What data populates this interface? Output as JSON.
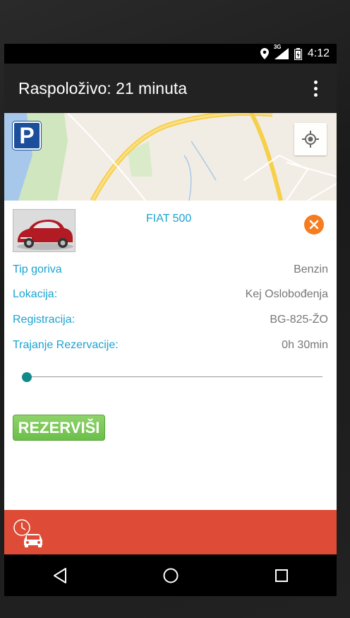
{
  "statusbar": {
    "signal_label": "3G",
    "time": "4:12"
  },
  "appbar": {
    "title": "Raspoloživo: 21 minuta",
    "menu_icon": "overflow-menu-icon"
  },
  "map": {
    "parking_label": "P"
  },
  "car": {
    "name": "FIAT 500",
    "details": [
      {
        "label": "Tip goriva",
        "value": "Benzin"
      },
      {
        "label": "Lokacija:",
        "value": "Kej Oslobođenja"
      },
      {
        "label": "Registracija:",
        "value": "BG-825-ŽO"
      },
      {
        "label": "Trajanje Rezervacije:",
        "value": "0h 30min"
      }
    ],
    "duration_slider_value": 0
  },
  "actions": {
    "reserve_label": "REZERVIŠI"
  },
  "colors": {
    "accent": "#1aa3d1",
    "bottom_bar": "#de4c37",
    "reserve": "#7bc95a",
    "close": "#f57c1f"
  }
}
